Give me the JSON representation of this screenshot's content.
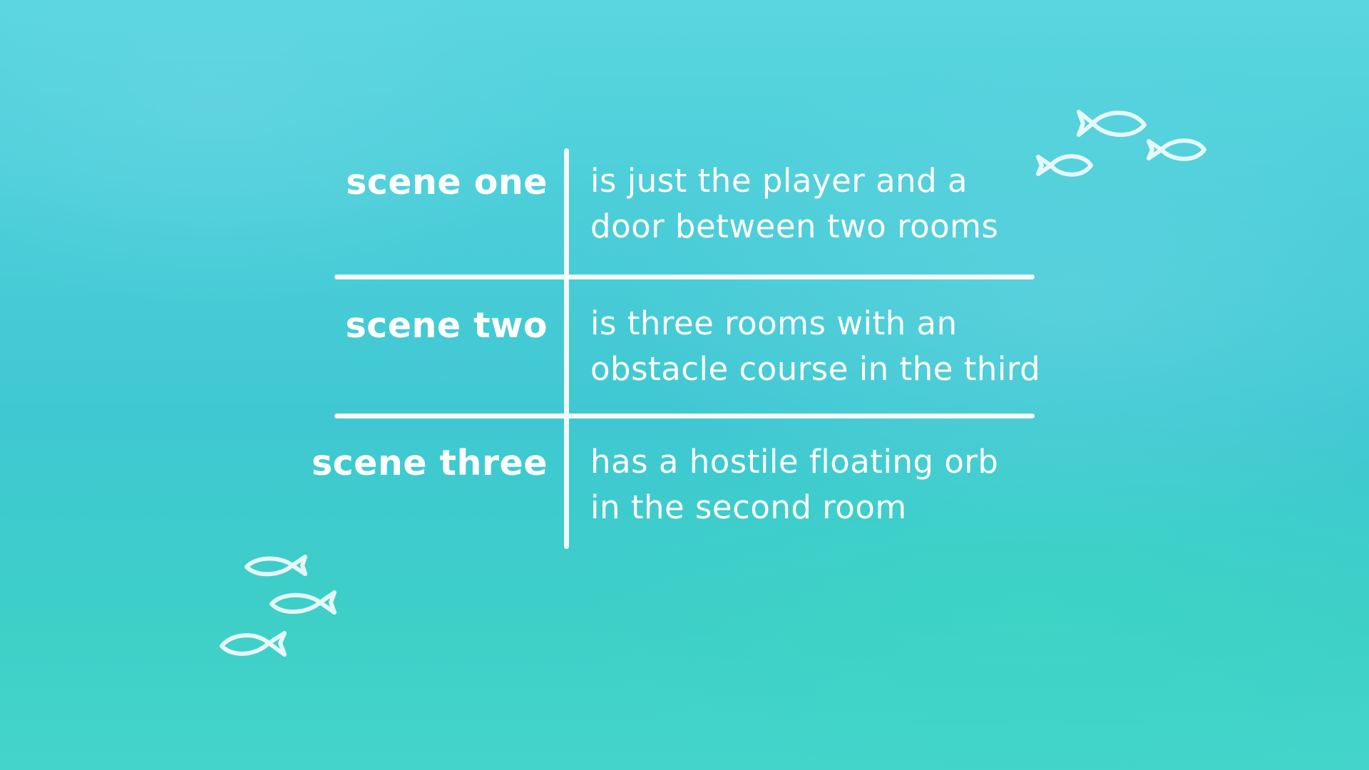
{
  "background": {
    "colors": [
      "#5ad6e0",
      "#3fc8d2",
      "#44d4cb"
    ]
  },
  "rows": [
    {
      "label": "scene one",
      "description": [
        "is just the player and a",
        "door between two rooms"
      ]
    },
    {
      "label": "scene two",
      "description": [
        "is three rooms with an",
        "obstacle course in the third"
      ]
    },
    {
      "label": "scene three",
      "description": [
        "has a hostile floating orb",
        "in the second room"
      ]
    }
  ],
  "decorations": {
    "icon": "fish-doodle-icon",
    "color": "#f4fbfb",
    "top_right_group_count": 3,
    "bottom_left_group_count": 3
  }
}
